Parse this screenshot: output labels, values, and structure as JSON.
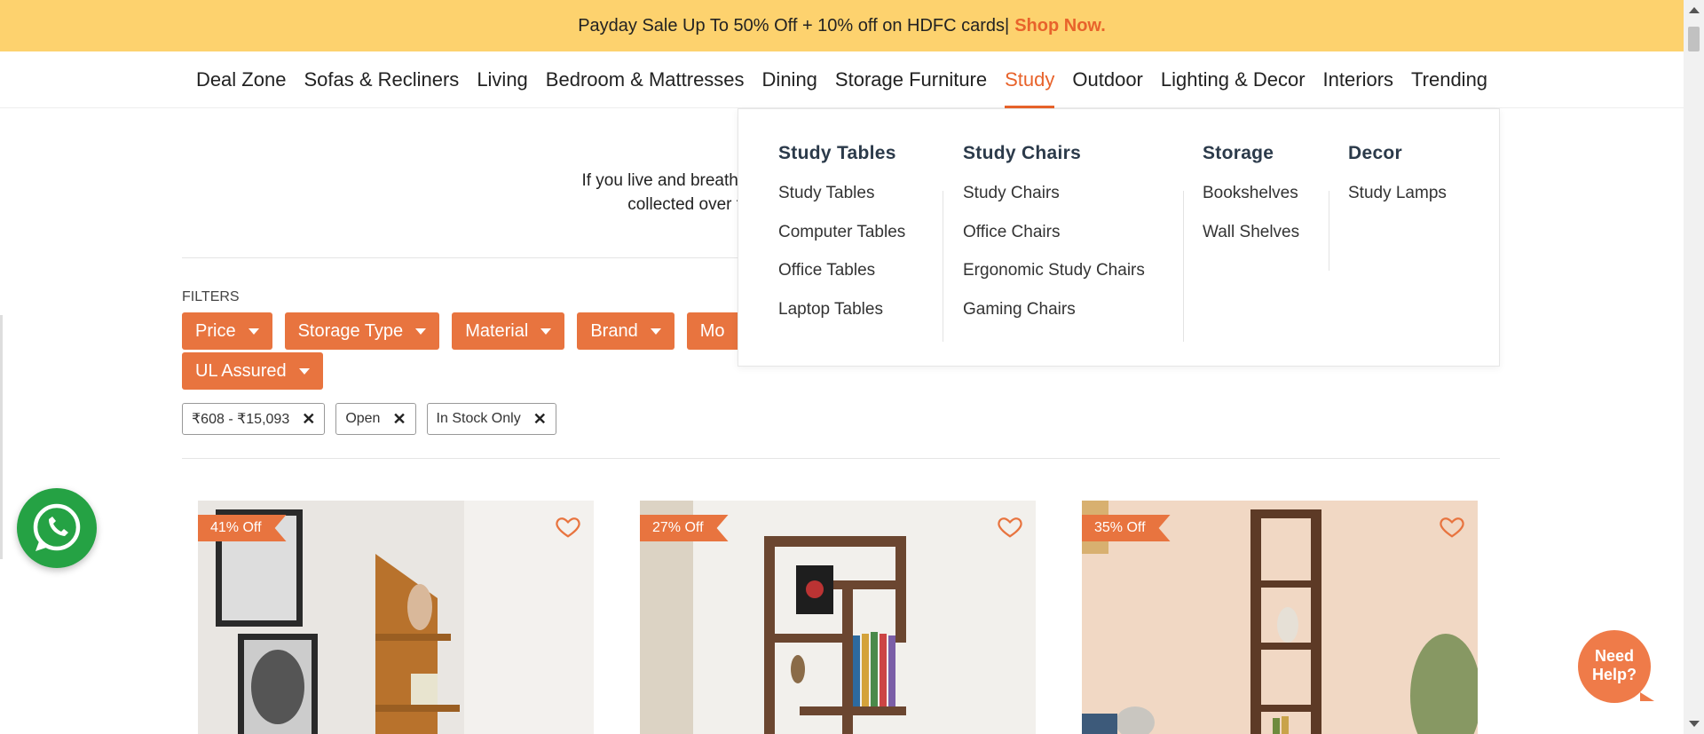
{
  "promo": {
    "text": "Payday Sale Up To 50% Off + 10% off on HDFC cards|",
    "cta": "Shop Now."
  },
  "nav": {
    "items": [
      {
        "label": "Deal Zone"
      },
      {
        "label": "Sofas & Recliners"
      },
      {
        "label": "Living"
      },
      {
        "label": "Bedroom & Mattresses"
      },
      {
        "label": "Dining"
      },
      {
        "label": "Storage Furniture"
      },
      {
        "label": "Study"
      },
      {
        "label": "Outdoor"
      },
      {
        "label": "Lighting & Decor"
      },
      {
        "label": "Interiors"
      },
      {
        "label": "Trending"
      }
    ],
    "active": "Study"
  },
  "description": {
    "line1": "If you live and breathe books then investing in a stunning bookshelf w",
    "line2": "collected over the years or personal memorabilia like pho"
  },
  "filters": {
    "title": "FILTERS",
    "buttons": [
      {
        "label": "Price"
      },
      {
        "label": "Storage Type"
      },
      {
        "label": "Material"
      },
      {
        "label": "Brand"
      },
      {
        "label": "Mo"
      },
      {
        "label": "UL Assured"
      }
    ],
    "chips": [
      {
        "label": "₹608 - ₹15,093"
      },
      {
        "label": "Open"
      },
      {
        "label": "In Stock Only"
      }
    ]
  },
  "products": [
    {
      "discount": "41% Off"
    },
    {
      "discount": "27% Off"
    },
    {
      "discount": "35% Off"
    }
  ],
  "dropdown": {
    "columns": [
      {
        "title": "Study Tables",
        "items": [
          "Study Tables",
          "Computer Tables",
          "Office Tables",
          "Laptop Tables"
        ]
      },
      {
        "title": "Study Chairs",
        "items": [
          "Study Chairs",
          "Office Chairs",
          "Ergonomic Study Chairs",
          "Gaming Chairs"
        ]
      },
      {
        "title": "Storage",
        "items": [
          "Bookshelves",
          "Wall Shelves"
        ]
      },
      {
        "title": "Decor",
        "items": [
          "Study Lamps"
        ]
      }
    ]
  },
  "help": {
    "line1": "Need",
    "line2": "Help?"
  },
  "colors": {
    "accent": "#e8743f",
    "promo_bg": "#fdd26e",
    "active_nav": "#e8632b",
    "whatsapp": "#25a244"
  },
  "icons": {
    "wishlist": "heart-outline-icon",
    "whatsapp": "whatsapp-icon",
    "remove": "close-icon",
    "dropdown": "caret-down-icon"
  }
}
